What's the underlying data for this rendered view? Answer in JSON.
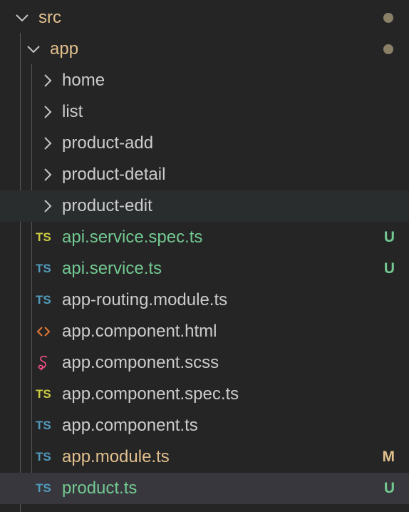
{
  "explorer": {
    "folders": {
      "src": {
        "label": "src",
        "expanded": true,
        "decoration": "modified-dot"
      },
      "app": {
        "label": "app",
        "expanded": true,
        "decoration": "modified-dot"
      }
    },
    "subfolders": [
      {
        "label": "home"
      },
      {
        "label": "list"
      },
      {
        "label": "product-add"
      },
      {
        "label": "product-detail"
      },
      {
        "label": "product-edit"
      }
    ],
    "files": [
      {
        "label": "api.service.spec.ts",
        "icon": "ts-spec-icon",
        "icon_text": "TS",
        "status": "U"
      },
      {
        "label": "api.service.ts",
        "icon": "ts-icon",
        "icon_text": "TS",
        "status": "U"
      },
      {
        "label": "app-routing.module.ts",
        "icon": "ts-icon",
        "icon_text": "TS",
        "status": ""
      },
      {
        "label": "app.component.html",
        "icon": "html-icon",
        "icon_text": "",
        "status": ""
      },
      {
        "label": "app.component.scss",
        "icon": "sass-icon",
        "icon_text": "",
        "status": ""
      },
      {
        "label": "app.component.spec.ts",
        "icon": "ts-spec-icon",
        "icon_text": "TS",
        "status": ""
      },
      {
        "label": "app.component.ts",
        "icon": "ts-icon",
        "icon_text": "TS",
        "status": ""
      },
      {
        "label": "app.module.ts",
        "icon": "ts-icon",
        "icon_text": "TS",
        "status": "M"
      },
      {
        "label": "product.ts",
        "icon": "ts-icon",
        "icon_text": "TS",
        "status": "U"
      }
    ]
  },
  "colors": {
    "background": "#252526",
    "untracked": "#73c991",
    "modified": "#e2c08d",
    "ts_icon": "#519aba",
    "ts_spec_icon": "#cbcb41",
    "html_icon": "#e37933",
    "sass_icon": "#f55385"
  }
}
